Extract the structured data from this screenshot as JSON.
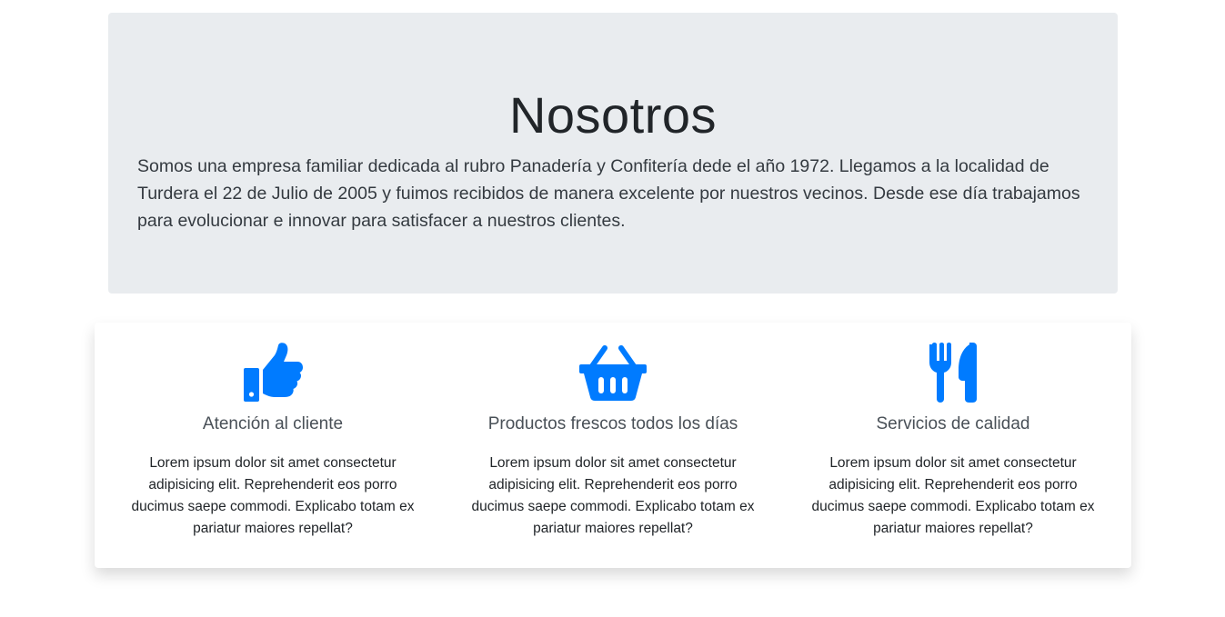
{
  "about": {
    "title": "Nosotros",
    "description": "Somos una empresa familiar dedicada al rubro Panadería y Confitería dede el año 1972. Llegamos a la localidad de Turdera el 22 de Julio de 2005 y fuimos recibidos de manera excelente por nuestros vecinos. Desde ese día trabajamos para evolucionar e innovar para satisfacer a nuestros clientes."
  },
  "features": [
    {
      "icon": "thumbs-up-icon",
      "title": "Atención al cliente",
      "text": "Lorem ipsum dolor sit amet consectetur adipisicing elit. Reprehenderit eos porro ducimus saepe commodi. Explicabo totam ex pariatur maiores repellat?"
    },
    {
      "icon": "shopping-basket-icon",
      "title": "Productos frescos todos los días",
      "text": "Lorem ipsum dolor sit amet consectetur adipisicing elit. Reprehenderit eos porro ducimus saepe commodi. Explicabo totam ex pariatur maiores repellat?"
    },
    {
      "icon": "utensils-icon",
      "title": "Servicios de calidad",
      "text": "Lorem ipsum dolor sit amet consectetur adipisicing elit. Reprehenderit eos porro ducimus saepe commodi. Explicabo totam ex pariatur maiores repellat?"
    }
  ],
  "colors": {
    "accent": "#007bff",
    "jumbotron_bg": "#e9ecef"
  }
}
